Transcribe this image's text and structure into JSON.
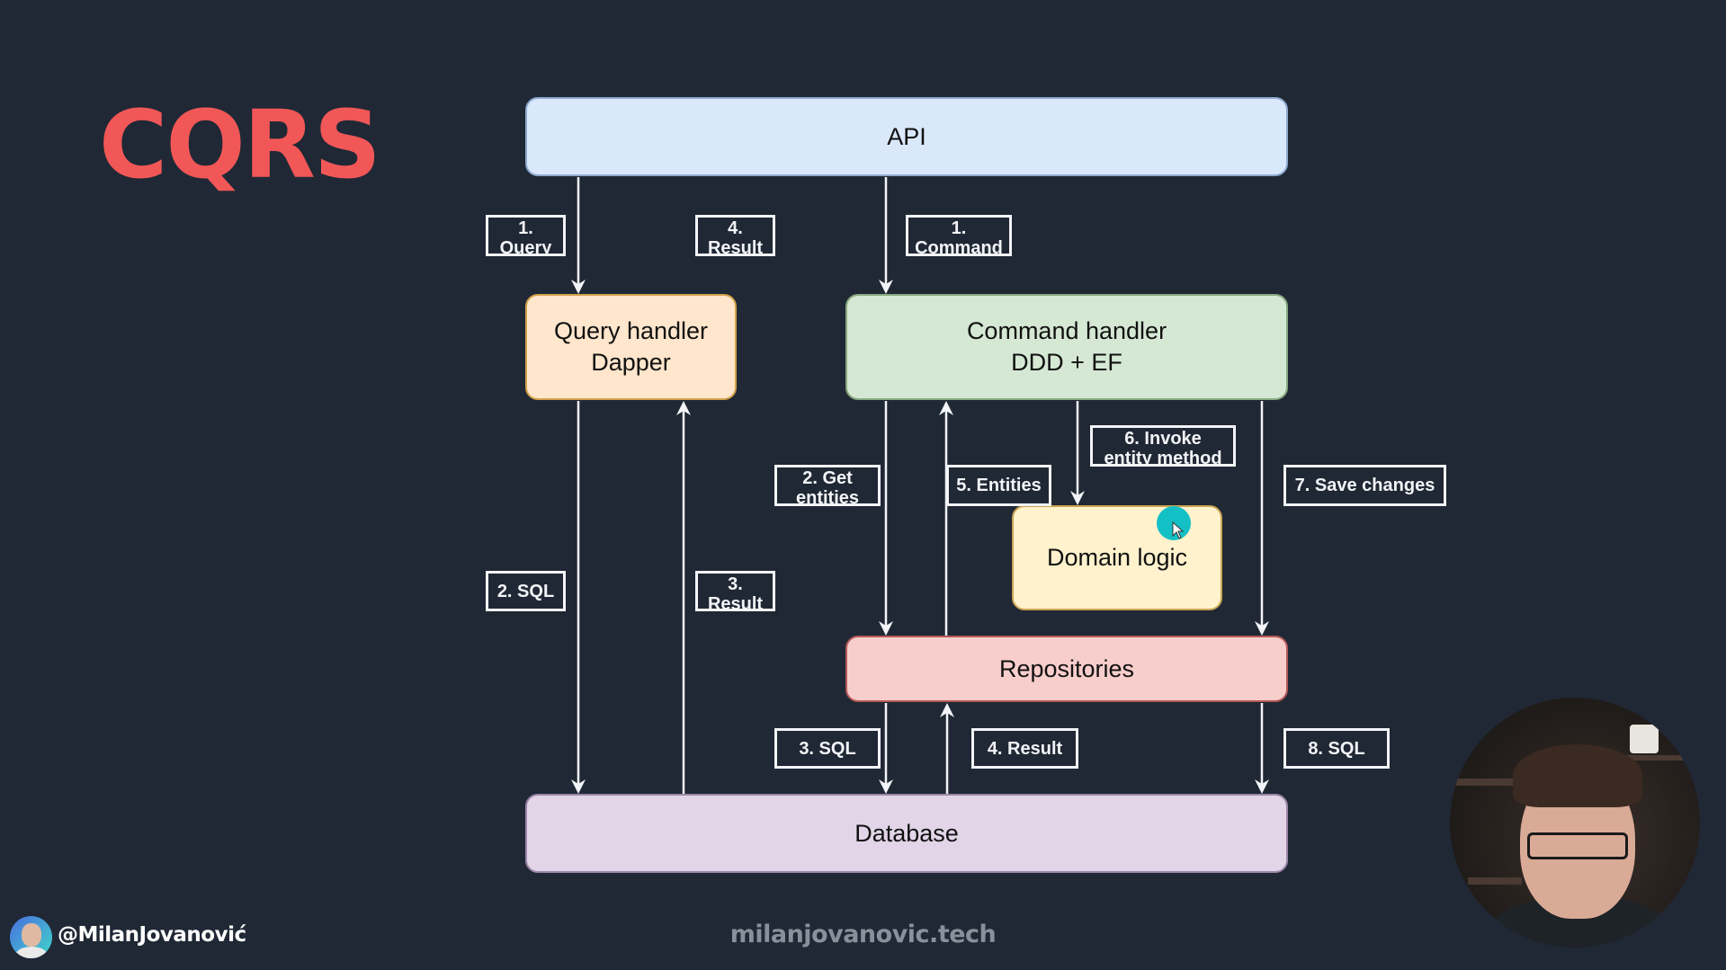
{
  "slide": {
    "title": "CQRS",
    "accent_color": "#f25757",
    "background_color": "#202835"
  },
  "nodes": {
    "api": {
      "label": "API",
      "fill": "#dae8fc"
    },
    "query_handler": {
      "line1": "Query handler",
      "line2": "Dapper",
      "fill": "#ffe6cc"
    },
    "command_handler": {
      "line1": "Command handler",
      "line2": "DDD + EF",
      "fill": "#d5e8d4"
    },
    "domain_logic": {
      "label": "Domain logic",
      "fill": "#fff2cc"
    },
    "repositories": {
      "label": "Repositories",
      "fill": "#f8cecc"
    },
    "database": {
      "label": "Database",
      "fill": "#e1d5e7"
    }
  },
  "edge_labels": {
    "query": {
      "line1": "1.",
      "line2": "Query"
    },
    "query_result": {
      "line1": "4.",
      "line2": "Result"
    },
    "command": {
      "line1": "1.",
      "line2": "Command"
    },
    "query_sql": "2. SQL",
    "sql_result": {
      "line1": "3.",
      "line2": "Result"
    },
    "get_entities": {
      "line1": "2. Get",
      "line2": "entities"
    },
    "entities": "5. Entities",
    "invoke_method": {
      "line1": "6. Invoke",
      "line2": "entity method"
    },
    "save_changes": "7. Save changes",
    "repo_sql": "3. SQL",
    "repo_result": "4. Result",
    "save_sql": "8. SQL"
  },
  "edges": [
    {
      "from": "api",
      "to": "query_handler",
      "label": "1. Query"
    },
    {
      "from": "query_handler",
      "to": "api",
      "label": "4. Result"
    },
    {
      "from": "api",
      "to": "command_handler",
      "label": "1. Command"
    },
    {
      "from": "query_handler",
      "to": "database",
      "label": "2. SQL"
    },
    {
      "from": "database",
      "to": "query_handler",
      "label": "3. Result"
    },
    {
      "from": "command_handler",
      "to": "repositories",
      "label": "2. Get entities"
    },
    {
      "from": "repositories",
      "to": "command_handler",
      "label": "5. Entities"
    },
    {
      "from": "command_handler",
      "to": "domain_logic",
      "label": "6. Invoke entity method"
    },
    {
      "from": "command_handler",
      "to": "repositories",
      "label": "7. Save changes"
    },
    {
      "from": "repositories",
      "to": "database",
      "label": "3. SQL"
    },
    {
      "from": "database",
      "to": "repositories",
      "label": "4. Result"
    },
    {
      "from": "repositories",
      "to": "database",
      "label": "8. SQL"
    }
  ],
  "footer": {
    "handle": "@MilanJovanović",
    "website": "milanjovanovic.tech"
  },
  "overlay": {
    "cursor_highlight_color": "#13c0c6"
  }
}
